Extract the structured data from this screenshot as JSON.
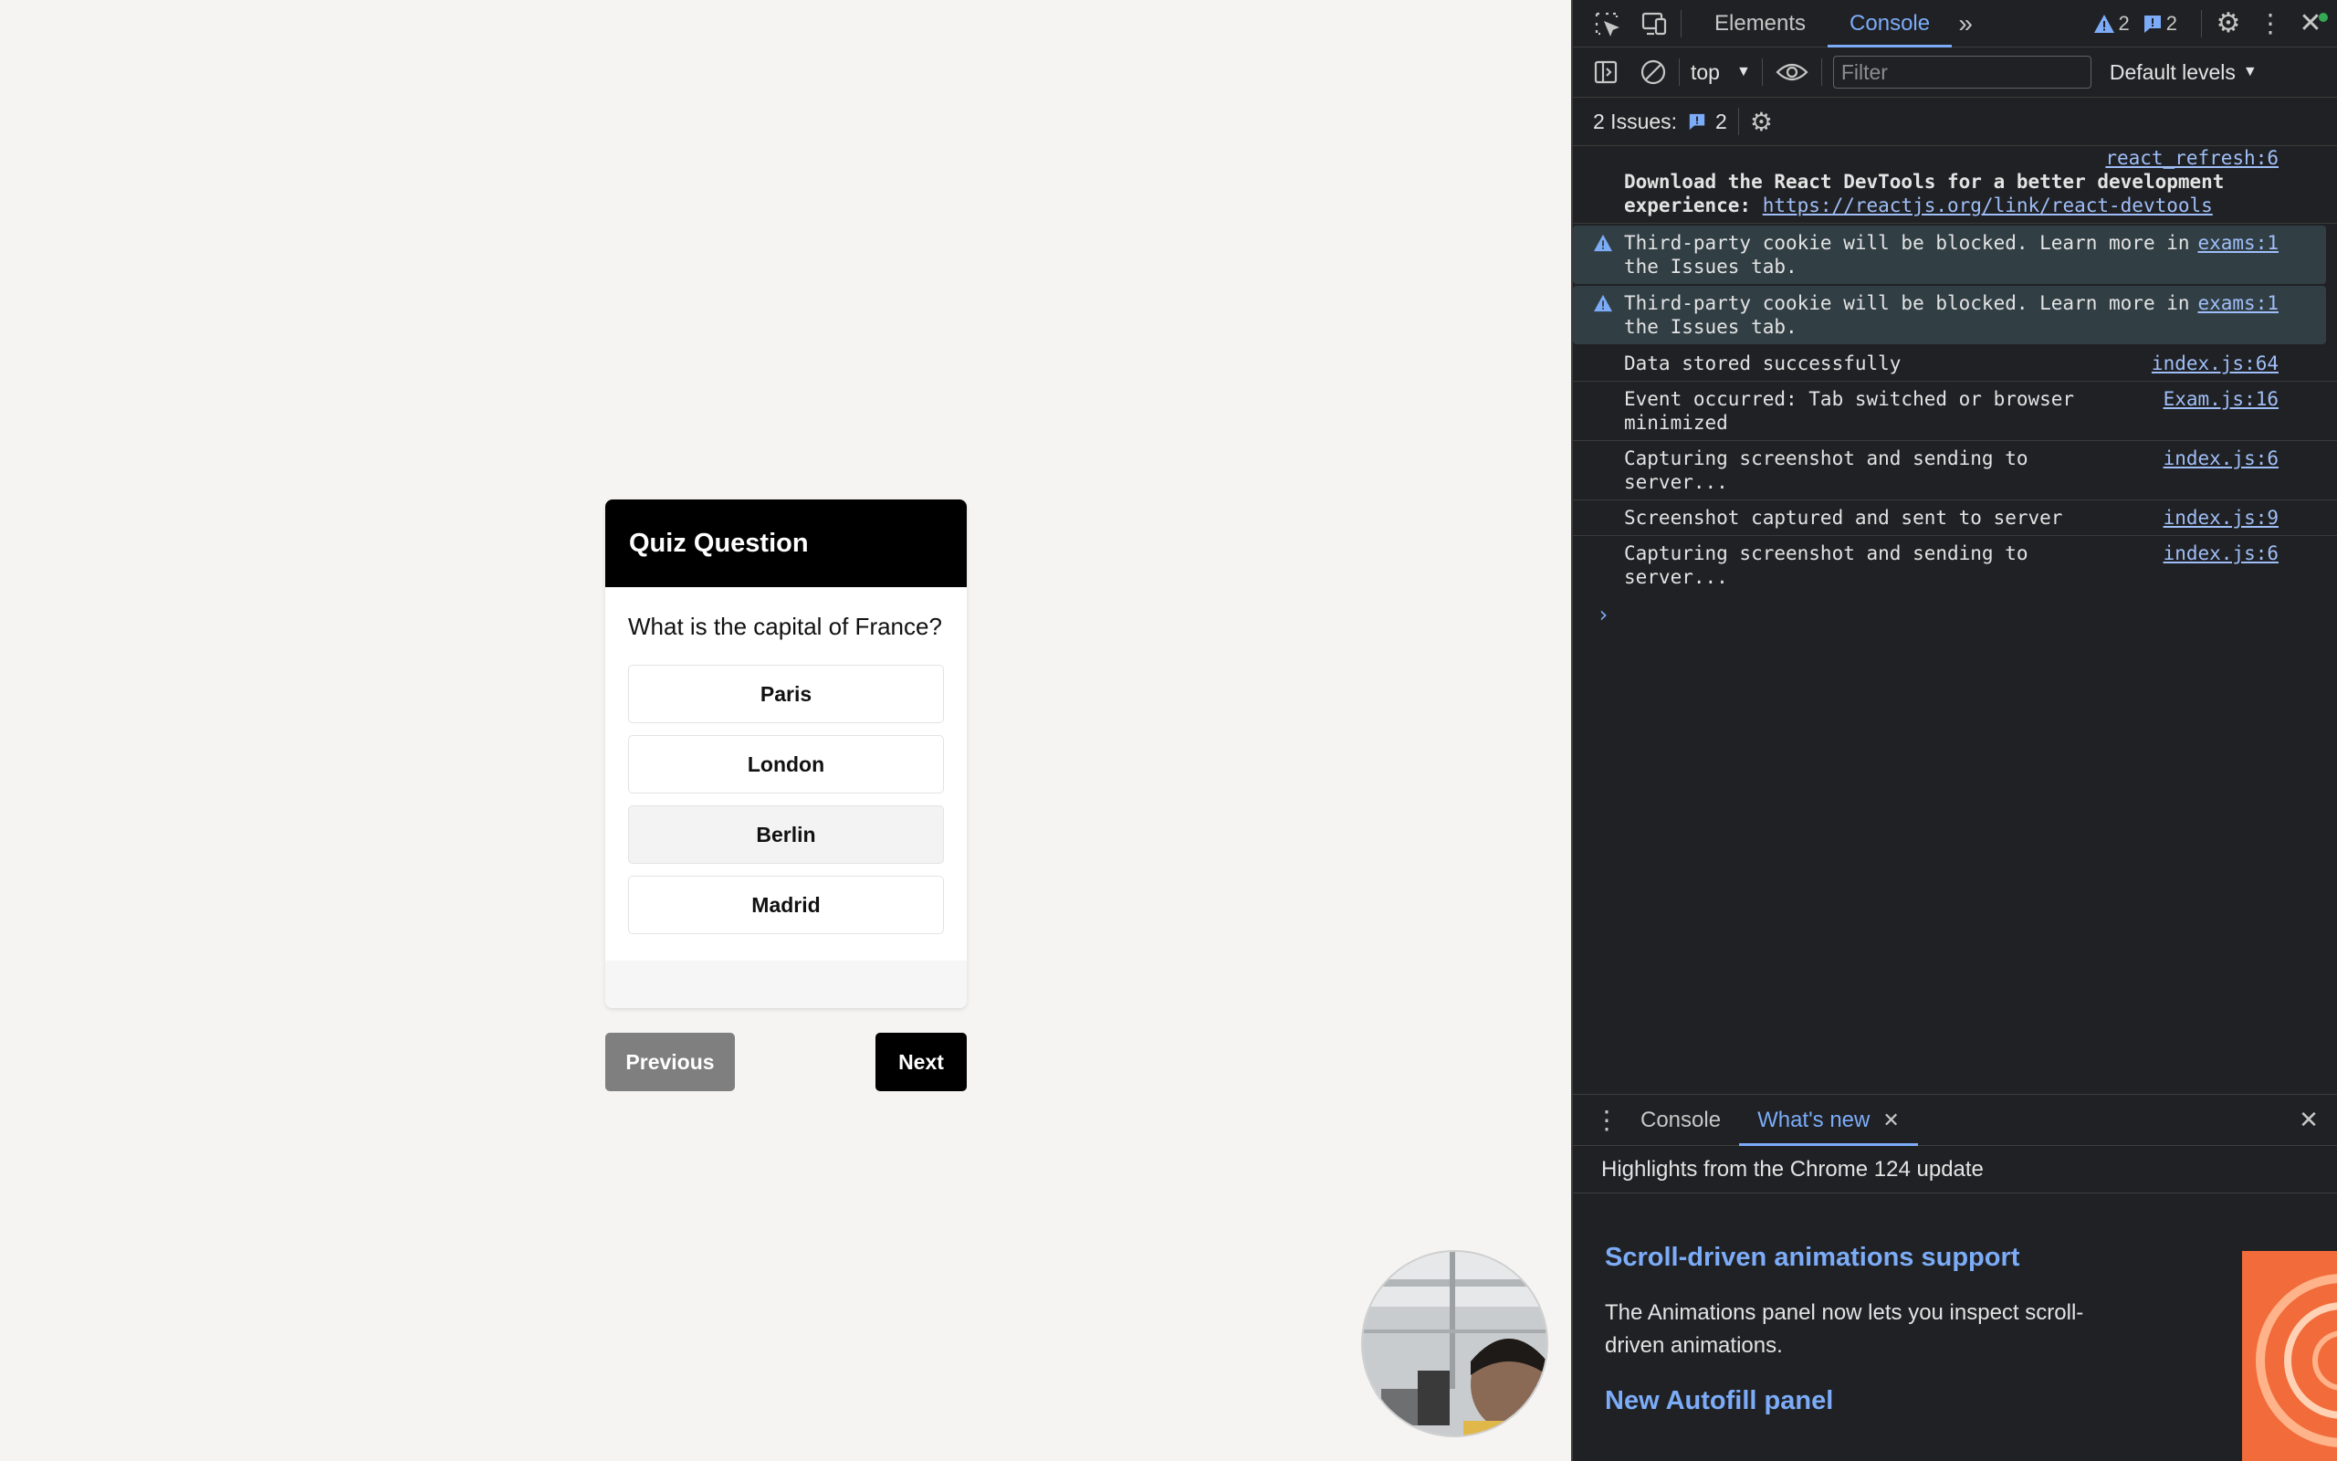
{
  "quiz": {
    "header": "Quiz Question",
    "question": "What is the capital of France?",
    "options": [
      "Paris",
      "London",
      "Berlin",
      "Madrid"
    ],
    "previous_label": "Previous",
    "next_label": "Next"
  },
  "devtools": {
    "tabs": [
      "Elements",
      "Console"
    ],
    "active_tab": "Console",
    "warning_count": "2",
    "info_count": "2",
    "context": "top",
    "filter_placeholder": "Filter",
    "levels": "Default levels",
    "issues_label": "2 Issues:",
    "issues_count": "2",
    "messages": [
      {
        "src": "react_refresh:6",
        "text_bold": "Download the React DevTools for a better development experience: ",
        "link": "https://reactjs.org/link/react-devtools"
      },
      {
        "src": "exams:1",
        "text": "Third-party cookie will be blocked. Learn more in the Issues tab."
      },
      {
        "src": "exams:1",
        "text": "Third-party cookie will be blocked. Learn more in the Issues tab."
      },
      {
        "src": "index.js:64",
        "text": "Data stored successfully"
      },
      {
        "src": "Exam.js:16",
        "text": "Event occurred: Tab switched or browser minimized"
      },
      {
        "src": "index.js:6",
        "text": "Capturing screenshot and sending to server..."
      },
      {
        "src": "index.js:9",
        "text": "Screenshot captured and sent to server"
      },
      {
        "src": "index.js:6",
        "text": "Capturing screenshot and sending to server..."
      }
    ],
    "drawer": {
      "tabs": [
        "Console",
        "What's new"
      ],
      "highlights": "Highlights from the Chrome 124 update",
      "items": [
        {
          "title": "Scroll-driven animations support",
          "body": "The Animations panel now lets you inspect scroll-driven animations."
        },
        {
          "title": "New Autofill panel",
          "body": ""
        }
      ]
    }
  },
  "colors": {
    "page_bg": "#f5f4f2",
    "devtools_bg": "#202124",
    "accent_blue": "#7cacf8",
    "warning_bg": "#313f45"
  }
}
